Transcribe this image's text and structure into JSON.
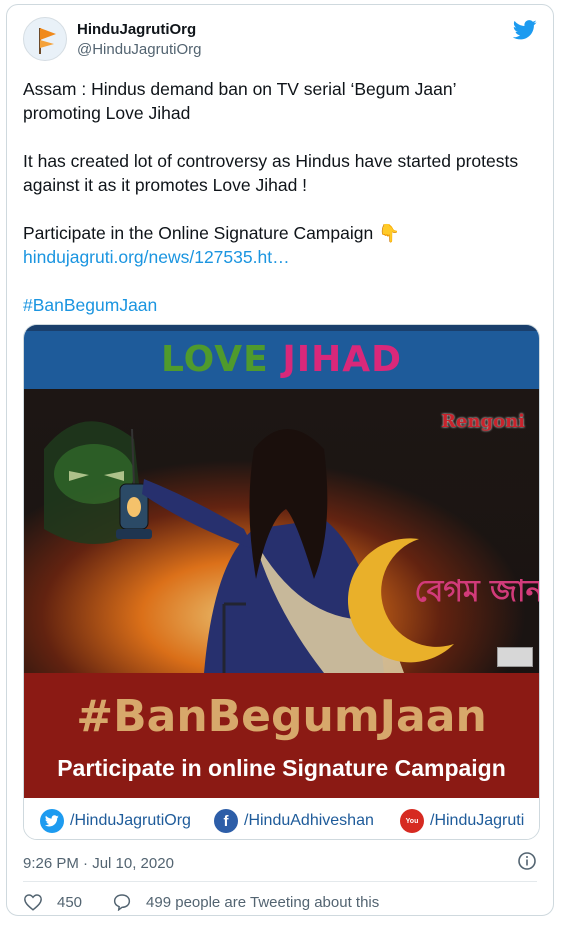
{
  "author": {
    "name": "HinduJagrutiOrg",
    "handle": "@HinduJagrutiOrg",
    "avatar_icon": "saffron-flag-icon"
  },
  "tweet": {
    "line1": "Assam : Hindus demand ban on TV serial ‘Begum Jaan’ promoting Love Jihad",
    "line2": "It has created lot of controversy as Hindus have started protests against it as it promotes Love Jihad !",
    "line3": "Participate in the Online Signature Campaign",
    "emoji": "👇",
    "link": "hindujagruti.org/news/127535.ht…",
    "hashtag": "#BanBegumJaan"
  },
  "media": {
    "banner_word1": "LOVE",
    "banner_word2": "JIHAD",
    "channel_logo": "Rengoni",
    "show_title_bengali": "বেগম জান",
    "hashtag": "#BanBegumJaan",
    "call_to_action": "Participate in online Signature Campaign",
    "socials": [
      {
        "icon": "twitter-icon",
        "label": "/HinduJagrutiOrg"
      },
      {
        "icon": "facebook-icon",
        "label": "/HinduAdhiveshan"
      },
      {
        "icon": "youtube-icon",
        "label": "/HinduJagruti"
      }
    ]
  },
  "meta": {
    "timestamp": "9:26 PM · Jul 10, 2020"
  },
  "actions": {
    "likes": "450",
    "conversation": "499 people are Tweeting about this"
  },
  "colors": {
    "link": "#1b95e0",
    "banner_blue": "#1e5b9a",
    "banner_red": "#8b1a14",
    "hashtag_gold": "#d7a86b"
  }
}
